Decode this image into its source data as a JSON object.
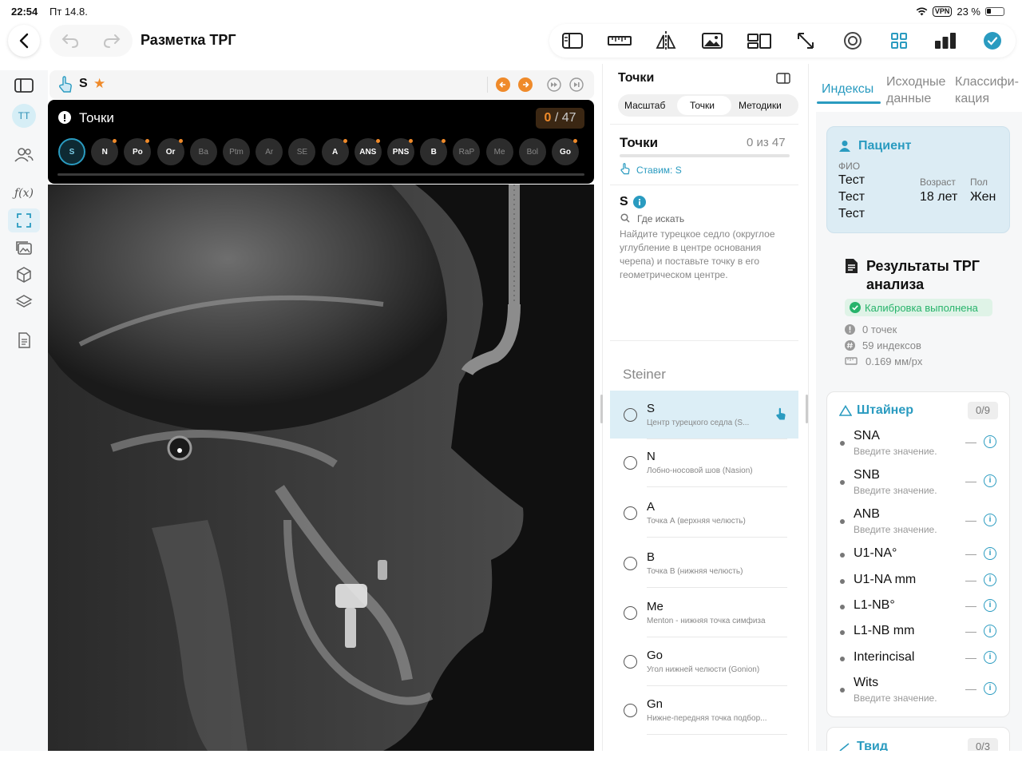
{
  "status_bar": {
    "time": "22:54",
    "date": "Пт 14.8.",
    "vpn": "VPN",
    "battery": "23 %"
  },
  "header": {
    "title": "Разметка ТРГ"
  },
  "toolbar": {
    "icons": [
      "sidebar-icon",
      "ruler-icon",
      "mirror-icon",
      "image-icon",
      "layout-icon",
      "resize-icon",
      "target-icon",
      "grid-icon",
      "bar-chart-icon",
      "check-icon"
    ]
  },
  "rail": {
    "avatar": "TT"
  },
  "image_header": {
    "point": "S"
  },
  "points_bar": {
    "title": "Точки",
    "counter_done": "0",
    "counter_total": "/ 47",
    "chips": [
      {
        "label": "S",
        "active": true,
        "dot": false,
        "dim": false
      },
      {
        "label": "N",
        "dot": true,
        "dim": false
      },
      {
        "label": "Po",
        "dot": true,
        "dim": false
      },
      {
        "label": "Or",
        "dot": true,
        "dim": false
      },
      {
        "label": "Ba",
        "dot": false,
        "dim": true
      },
      {
        "label": "Ptm",
        "dot": false,
        "dim": true
      },
      {
        "label": "Ar",
        "dot": false,
        "dim": true
      },
      {
        "label": "SE",
        "dot": false,
        "dim": true
      },
      {
        "label": "A",
        "dot": true,
        "dim": false
      },
      {
        "label": "ANS",
        "dot": true,
        "dim": false
      },
      {
        "label": "PNS",
        "dot": true,
        "dim": false
      },
      {
        "label": "B",
        "dot": true,
        "dim": false
      },
      {
        "label": "RaP",
        "dot": false,
        "dim": true
      },
      {
        "label": "Me",
        "dot": false,
        "dim": true
      },
      {
        "label": "Bol",
        "dot": false,
        "dim": true
      },
      {
        "label": "Go",
        "dot": true,
        "dim": false
      }
    ]
  },
  "middle": {
    "title": "Точки",
    "segments": [
      "Масштаб",
      "Точки",
      "Методики"
    ],
    "points_title": "Точки",
    "points_count": "0 из 47",
    "placing": "Ставим: S",
    "current_point": "S",
    "where_label": "Где искать",
    "where_text": "Найдите турецкое седло (округлое углубление в центре основания черепа) и поставьте точку в его геометрическом центре.",
    "group": "Steiner",
    "items": [
      {
        "name": "S",
        "desc": "Центр турецкого седла (S..."
      },
      {
        "name": "N",
        "desc": "Лобно-носовой шов (Nasion)"
      },
      {
        "name": "A",
        "desc": "Точка А (верхняя челюсть)"
      },
      {
        "name": "B",
        "desc": "Точка В (нижняя челюсть)"
      },
      {
        "name": "Me",
        "desc": "Menton - нижняя точка симфиза"
      },
      {
        "name": "Go",
        "desc": "Угол нижней челюсти (Gonion)"
      },
      {
        "name": "Gn",
        "desc": "Нижне-передняя точка подбор..."
      }
    ]
  },
  "right": {
    "tabs": [
      "Индексы",
      "Исходные данные",
      "Классифи-кация"
    ],
    "patient": {
      "title": "Пациент",
      "fio_label": "ФИО",
      "fio": [
        "Тест",
        "Тест",
        "Тест"
      ],
      "age_label": "Возраст",
      "age": "18 лет",
      "sex_label": "Пол",
      "sex": "Жен"
    },
    "results": {
      "title_line1": "Результаты ТРГ",
      "title_line2": "анализа",
      "calibration": "Калибровка выполнена",
      "points": "0 точек",
      "indices": "59 индексов",
      "scale": "0.169 мм/px"
    },
    "steiner": {
      "title": "Штайнер",
      "count": "0/9",
      "items": [
        {
          "name": "SNA",
          "hint": "Введите значение."
        },
        {
          "name": "SNB",
          "hint": "Введите значение."
        },
        {
          "name": "ANB",
          "hint": "Введите значение."
        },
        {
          "name": "U1-NA°",
          "hint": ""
        },
        {
          "name": "U1-NA mm",
          "hint": ""
        },
        {
          "name": "L1-NB°",
          "hint": ""
        },
        {
          "name": "L1-NB mm",
          "hint": ""
        },
        {
          "name": "Interincisal",
          "hint": ""
        },
        {
          "name": "Wits",
          "hint": "Введите значение."
        }
      ],
      "dash": "—"
    },
    "tweed": {
      "title": "Твид",
      "count": "0/3"
    }
  },
  "colors": {
    "accent": "#2a9bc0",
    "orange": "#ef8a2a",
    "green": "#27b36b"
  }
}
